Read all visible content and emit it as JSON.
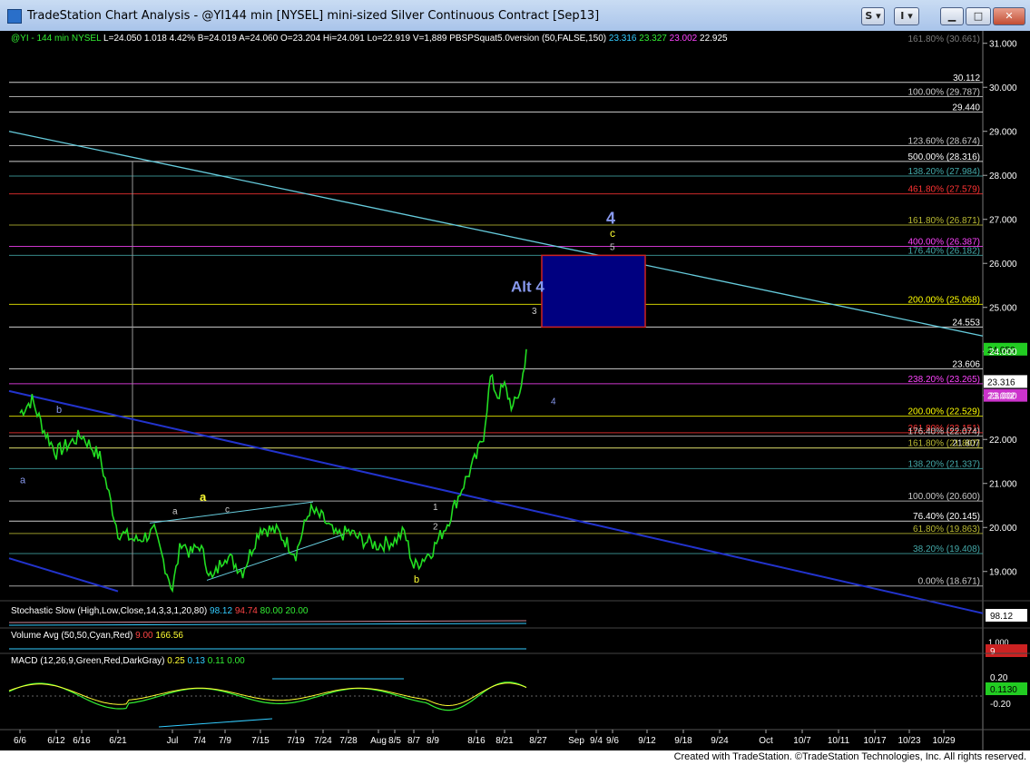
{
  "window": {
    "title": "TradeStation Chart Analysis - @YI144 min [NYSEL] mini-sized Silver Continuous Contract [Sep13]",
    "buttons": {
      "s": "S",
      "i": "I"
    }
  },
  "footer": "Created with TradeStation. ©TradeStation Technologies, Inc. All rights reserved.",
  "colors": {
    "background": "#000000",
    "price": "#22dd22",
    "resistance_line": "#66ccdd",
    "channel": "#2233cc",
    "target_box": "#000080",
    "target_border": "#cc2222"
  },
  "chart_data": {
    "type": "line",
    "header": {
      "symbol": "@YI - 144 min NYSEL",
      "stats": "L=24.050 1.018 4.42% B=24.019 A=24.060 O=23.204 Hi=24.091 Lo=22.919 V=1,889",
      "indicator": "PBSPSquat5.0version (50,FALSE,150)",
      "indicator_values": [
        "23.316",
        "23.327",
        "23.002",
        "22.925"
      ]
    },
    "x_ticks": [
      "6/6",
      "6/12",
      "6/16",
      "6/21",
      "Jul",
      "7/4",
      "7/9",
      "7/15",
      "7/19",
      "7/24",
      "7/28",
      "Aug",
      "8/5",
      "8/7",
      "8/9",
      "8/16",
      "8/21",
      "8/27",
      "Sep",
      "9/4",
      "9/6",
      "9/12",
      "9/18",
      "9/24",
      "Oct",
      "10/7",
      "10/11",
      "10/17",
      "10/23",
      "10/29"
    ],
    "y_ticks": [
      31,
      30,
      29,
      28,
      27,
      26,
      25,
      24,
      23,
      22,
      21,
      20,
      19
    ],
    "ylim": [
      18.5,
      31.2
    ],
    "price_series": [
      [
        "6/6",
        22.6
      ],
      [
        "6/6",
        22.9
      ],
      [
        "6/6",
        22.2
      ],
      [
        "6/12",
        21.7
      ],
      [
        "6/12",
        21.9
      ],
      [
        "6/16",
        22.1
      ],
      [
        "6/16",
        21.6
      ],
      [
        "6/21",
        19.9
      ],
      [
        "6/21",
        19.7
      ],
      [
        "6/21",
        19.9
      ],
      [
        "Jul",
        18.6
      ],
      [
        "Jul",
        19.7
      ],
      [
        "Jul",
        19.4
      ],
      [
        "7/4",
        19.6
      ],
      [
        "7/4",
        18.8
      ],
      [
        "7/9",
        19.4
      ],
      [
        "7/9",
        19.0
      ],
      [
        "7/15",
        20.0
      ],
      [
        "7/15",
        19.9
      ],
      [
        "7/19",
        19.4
      ],
      [
        "7/19",
        20.4
      ],
      [
        "7/24",
        20.2
      ],
      [
        "7/24",
        19.8
      ],
      [
        "7/28",
        19.9
      ],
      [
        "7/28",
        19.7
      ],
      [
        "Aug",
        19.6
      ],
      [
        "8/5",
        19.7
      ],
      [
        "8/5",
        19.9
      ],
      [
        "8/7",
        19.1
      ],
      [
        "8/9",
        19.5
      ],
      [
        "8/9",
        20.1
      ],
      [
        "8/9",
        20.9
      ],
      [
        "8/16",
        21.6
      ],
      [
        "8/16",
        22.1
      ],
      [
        "8/16",
        23.4
      ],
      [
        "8/16",
        23.0
      ],
      [
        "8/21",
        23.2
      ],
      [
        "8/21",
        22.7
      ],
      [
        "8/21",
        23.2
      ],
      [
        "8/21",
        24.05
      ]
    ],
    "fib_levels": [
      {
        "label": "30.112",
        "value": 30.112,
        "color": "#ffffff"
      },
      {
        "label": "100.00% (29.787)",
        "value": 29.787,
        "color": "#cccccc"
      },
      {
        "label": "29.440",
        "value": 29.44,
        "color": "#ffffff"
      },
      {
        "label": "123.60% (28.674)",
        "value": 28.674,
        "color": "#cccccc"
      },
      {
        "label": "500.00% (28.316)",
        "value": 28.316,
        "color": "#ffffff"
      },
      {
        "label": "138.20% (27.984)",
        "value": 27.984,
        "color": "#44aaaa"
      },
      {
        "label": "461.80% (27.579)",
        "value": 27.579,
        "color": "#ff3333"
      },
      {
        "label": "161.80% (26.871)",
        "value": 26.871,
        "color": "#bbbb33"
      },
      {
        "label": "400.00% (26.387)",
        "value": 26.387,
        "color": "#ff44ff"
      },
      {
        "label": "176.40% (26.182)",
        "value": 26.182,
        "color": "#44aaaa"
      },
      {
        "label": "200.00% (25.068)",
        "value": 25.068,
        "color": "#ffff00"
      },
      {
        "label": "24.553",
        "value": 24.553,
        "color": "#ffffff"
      },
      {
        "label": "23.606",
        "value": 23.606,
        "color": "#ffffff"
      },
      {
        "label": "238.20% (23.265)",
        "value": 23.265,
        "color": "#ff44ff"
      },
      {
        "label": "200.00% (22.529)",
        "value": 22.529,
        "color": "#ffff00"
      },
      {
        "label": "261.80% (22.151)",
        "value": 22.151,
        "color": "#ff3333"
      },
      {
        "label": "176.40% (22.074)",
        "value": 22.074,
        "color": "#cccccc"
      },
      {
        "label": "21.807",
        "value": 21.807,
        "color": "#ffffff"
      },
      {
        "label": "161.80% (21.807)",
        "value": 21.807,
        "color": "#bbbb33"
      },
      {
        "label": "138.20% (21.337)",
        "value": 21.337,
        "color": "#44aaaa"
      },
      {
        "label": "100.00% (20.600)",
        "value": 20.6,
        "color": "#cccccc"
      },
      {
        "label": "76.40% (20.145)",
        "value": 20.145,
        "color": "#ffffff"
      },
      {
        "label": "61.80% (19.863)",
        "value": 19.863,
        "color": "#bbbb33"
      },
      {
        "label": "38.20% (19.408)",
        "value": 19.408,
        "color": "#44aaaa"
      },
      {
        "label": "0.00% (18.671)",
        "value": 18.671,
        "color": "#cccccc"
      }
    ],
    "top_partial_label": "161.80% (30.661)",
    "current_tags": [
      {
        "label": "24.050",
        "value": 24.05,
        "bg": "#22cc22",
        "fg": "#000000"
      },
      {
        "label": "23.316",
        "value": 23.316,
        "bg": "#ffffff",
        "fg": "#000000"
      },
      {
        "label": "23.002",
        "value": 23.002,
        "bg": "#cc33cc",
        "fg": "#ffffff"
      }
    ],
    "wave_labels": [
      {
        "text": "4",
        "x": "9/4",
        "value": 26.9,
        "color": "#8899ee",
        "size": 18
      },
      {
        "text": "c",
        "x": "9/4",
        "value": 26.6,
        "color": "#ffff33",
        "size": 12
      },
      {
        "text": "5",
        "x": "9/4",
        "value": 26.3,
        "color": "#cccccc",
        "size": 10
      },
      {
        "text": "Alt 4",
        "x": "8/21",
        "value": 25.35,
        "color": "#8899ee",
        "size": 17
      },
      {
        "text": "3",
        "x": "8/21",
        "value": 24.85,
        "color": "#cccccc",
        "size": 10
      },
      {
        "text": "4",
        "x": "8/27",
        "value": 22.8,
        "color": "#8899ee",
        "size": 10
      },
      {
        "text": "b",
        "x": "6/12",
        "value": 22.6,
        "color": "#8899ee",
        "size": 11
      },
      {
        "text": "a",
        "x": "6/6",
        "value": 21.0,
        "color": "#8899ee",
        "size": 11
      },
      {
        "text": "a",
        "x": "7/4",
        "value": 20.6,
        "color": "#ffff33",
        "size": 13
      },
      {
        "text": "a",
        "x": "Jul",
        "value": 20.3,
        "color": "#cccccc",
        "size": 10
      },
      {
        "text": "c",
        "x": "7/9",
        "value": 20.35,
        "color": "#cccccc",
        "size": 10
      },
      {
        "text": "1",
        "x": "8/9",
        "value": 20.4,
        "color": "#cccccc",
        "size": 10
      },
      {
        "text": "2",
        "x": "8/9",
        "value": 19.95,
        "color": "#cccccc",
        "size": 10
      },
      {
        "text": "b",
        "x": "8/7",
        "value": 18.75,
        "color": "#ffff33",
        "size": 11
      }
    ],
    "target_zone": {
      "x_start": "8/27",
      "x_end": "9/12",
      "low": 24.553,
      "high": 26.182
    },
    "stochastic": {
      "label": "Stochastic Slow (High,Low,Close,14,3,3,1,20,80)",
      "values": [
        "98.12",
        "94.74",
        "80.00",
        "20.00"
      ],
      "tag": "98.12"
    },
    "volume_avg": {
      "label": "Volume Avg (50,50,Cyan,Red)",
      "values": [
        "9.00",
        "166.56"
      ],
      "axis": "1,000",
      "tag": "9"
    },
    "macd": {
      "label": "MACD (12,26,9,Green,Red,DarkGray)",
      "values": [
        "0.25",
        "0.13",
        "0.11",
        "0.00"
      ],
      "axis": [
        "0.20",
        "-0.20"
      ],
      "tag": "0.1130"
    }
  }
}
